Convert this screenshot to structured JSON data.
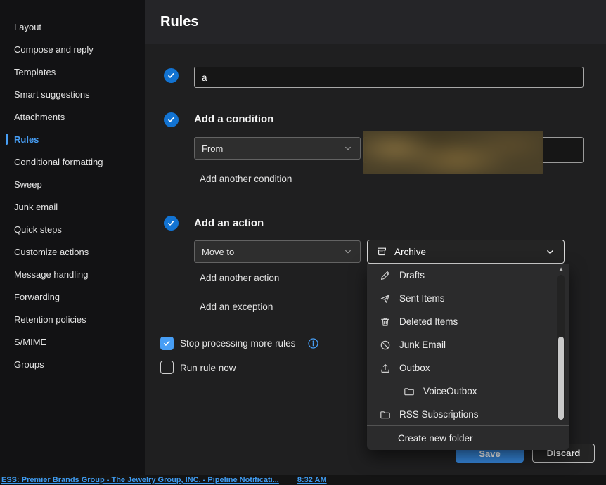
{
  "colors": {
    "accent": "#479ef5",
    "step_circle": "#1273d2",
    "save_button": "#3584d6"
  },
  "header": {
    "title": "Rules"
  },
  "sidebar": {
    "items": [
      {
        "label": "Layout"
      },
      {
        "label": "Compose and reply"
      },
      {
        "label": "Templates"
      },
      {
        "label": "Smart suggestions"
      },
      {
        "label": "Attachments"
      },
      {
        "label": "Rules",
        "selected": true
      },
      {
        "label": "Conditional formatting"
      },
      {
        "label": "Sweep"
      },
      {
        "label": "Junk email"
      },
      {
        "label": "Quick steps"
      },
      {
        "label": "Customize actions"
      },
      {
        "label": "Message handling"
      },
      {
        "label": "Forwarding"
      },
      {
        "label": "Retention policies"
      },
      {
        "label": "S/MIME"
      },
      {
        "label": "Groups"
      }
    ]
  },
  "rule": {
    "name": {
      "value": "a"
    },
    "condition": {
      "heading": "Add a condition",
      "selected_option": "From",
      "add_link": "Add another condition"
    },
    "action": {
      "heading": "Add an action",
      "selected_option": "Move to",
      "folder_value": "Archive",
      "add_action_link": "Add another action",
      "add_exception_link": "Add an exception"
    },
    "stop_processing": {
      "label": "Stop processing more rules",
      "checked": true
    },
    "run_now": {
      "label": "Run rule now",
      "checked": false
    }
  },
  "folder_menu": {
    "items": [
      {
        "label": "Drafts",
        "icon": "drafts-icon"
      },
      {
        "label": "Sent Items",
        "icon": "sent-items-icon"
      },
      {
        "label": "Deleted Items",
        "icon": "deleted-items-icon"
      },
      {
        "label": "Junk Email",
        "icon": "junk-email-icon"
      },
      {
        "label": "Outbox",
        "icon": "outbox-icon"
      },
      {
        "label": "VoiceOutbox",
        "icon": "folder-icon",
        "indent": 1
      },
      {
        "label": "RSS Subscriptions",
        "icon": "folder-icon"
      }
    ],
    "create_link": "Create new folder"
  },
  "buttons": {
    "save": "Save",
    "discard": "Discard"
  },
  "taskbar": {
    "title": "ESS: Premier Brands Group - The Jewelry Group, INC. - Pipeline Notificati...",
    "time": "8:32 AM"
  }
}
